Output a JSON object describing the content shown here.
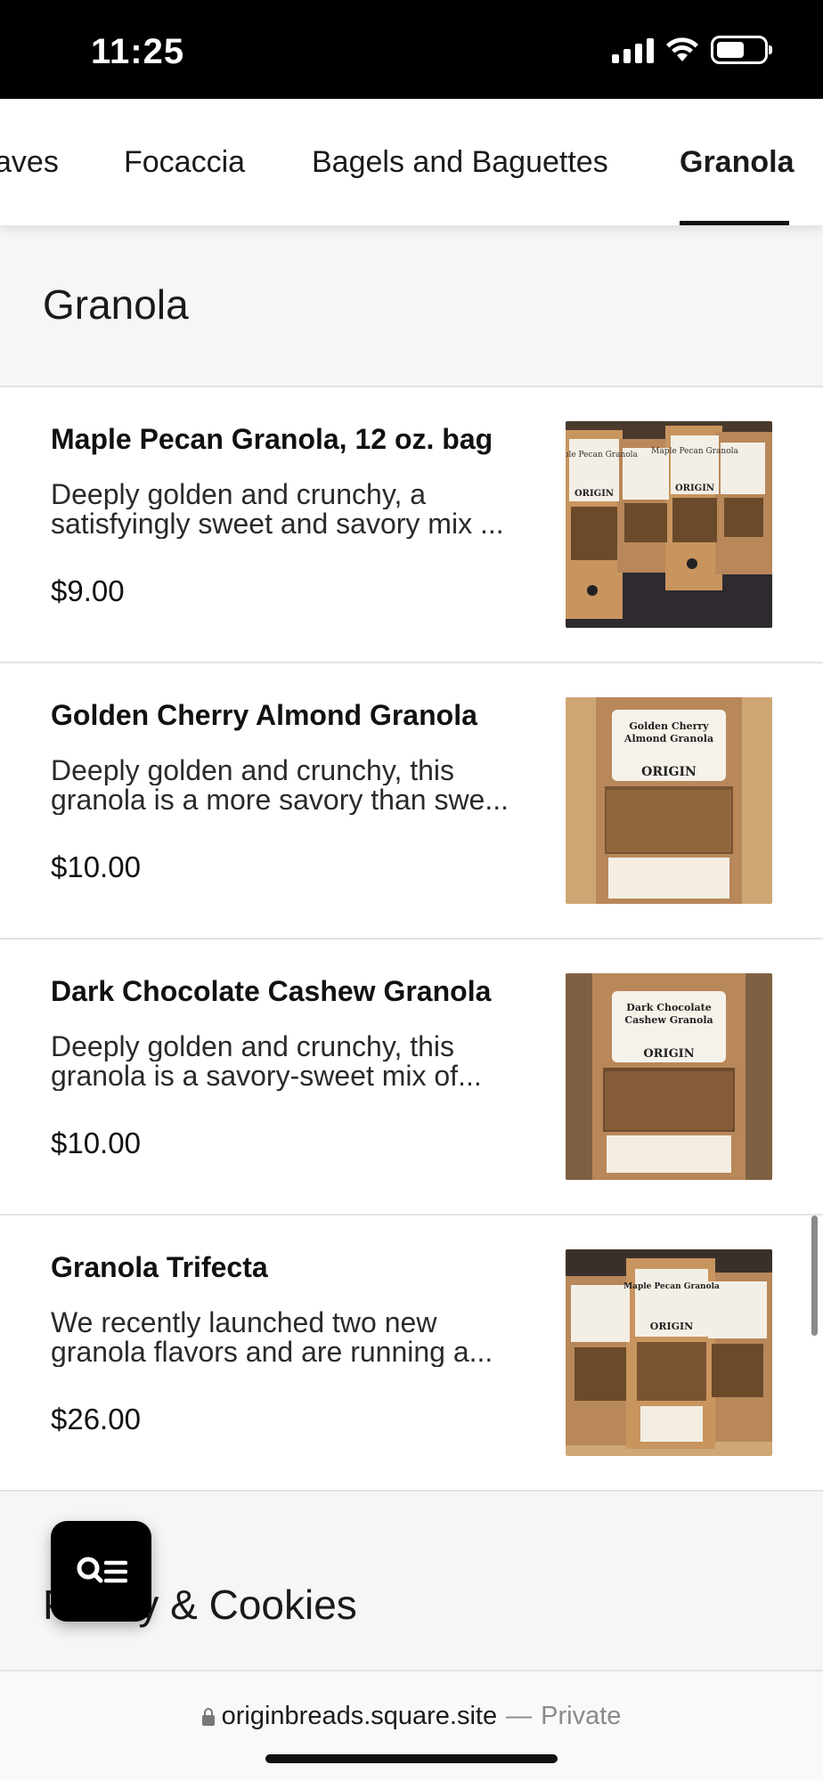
{
  "status_bar": {
    "time": "11:25"
  },
  "tabs": [
    {
      "label": "aves"
    },
    {
      "label": "Focaccia"
    },
    {
      "label": "Bagels and Baguettes"
    },
    {
      "label": "Granola",
      "active": true
    }
  ],
  "section": {
    "title": "Granola"
  },
  "products": [
    {
      "name": "Maple Pecan Granola, 12 oz. bag",
      "desc_line1": "Deeply golden and crunchy, a",
      "desc_line2": "satisfyingly sweet and savory mix ...",
      "price": "$9.00",
      "image_label": "Maple Pecan Granola",
      "image_brand": "ORIGIN"
    },
    {
      "name": "Golden Cherry Almond Granola",
      "desc_line1": "Deeply golden and crunchy, this",
      "desc_line2": "granola is a more savory than swe...",
      "price": "$10.00",
      "image_label": "Golden Cherry Almond Granola",
      "image_brand": "ORIGIN"
    },
    {
      "name": "Dark Chocolate Cashew Granola",
      "desc_line1": "Deeply golden and crunchy, this",
      "desc_line2": "granola is a savory-sweet mix of...",
      "price": "$10.00",
      "image_label": "Dark Chocolate Cashew Granola",
      "image_brand": "ORIGIN"
    },
    {
      "name": "Granola Trifecta",
      "desc_line1": "We recently launched two new",
      "desc_line2": "granola flavors and are running a...",
      "price": "$26.00",
      "image_label": "Maple Pecan Granola",
      "image_brand": "ORIGIN"
    }
  ],
  "next_section": {
    "title": "Pastry & Cookies"
  },
  "browser": {
    "url": "originbreads.square.site",
    "separator": "—",
    "mode": "Private"
  },
  "colors": {
    "accent": "#111111",
    "background": "#f5f6f8",
    "card": "#ffffff",
    "kraft": "#b8875a"
  },
  "icons": {
    "fab": "search-menu-icon",
    "lock": "lock-icon"
  }
}
